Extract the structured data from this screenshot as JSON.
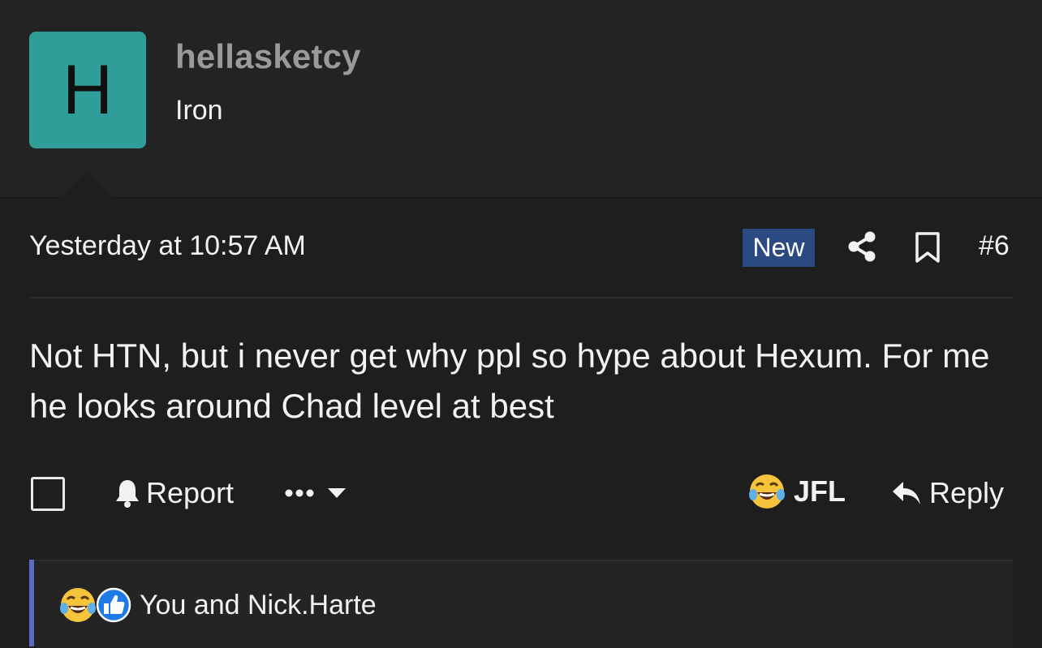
{
  "user": {
    "avatar_letter": "H",
    "avatar_color": "#2f9e98",
    "username": "hellasketcy",
    "title": "Iron"
  },
  "post": {
    "timestamp": "Yesterday at 10:57 AM",
    "new_badge": "New",
    "number": "#6",
    "body": "Not HTN, but i never get why ppl so hype about Hexum. For me he looks around Chad level at best"
  },
  "actions": {
    "report_label": "Report",
    "jfl_label": "JFL",
    "reply_label": "Reply"
  },
  "reactions": {
    "icons": [
      "laughing-crying-emoji-icon",
      "thumbs-up-icon"
    ],
    "summary": "You and Nick.Harte"
  },
  "colors": {
    "background": "#1e1e1e",
    "header": "#232323",
    "new_badge": "#2c4a82",
    "reaction_accent": "#5b6bbd",
    "username": "#9a9a9a"
  }
}
